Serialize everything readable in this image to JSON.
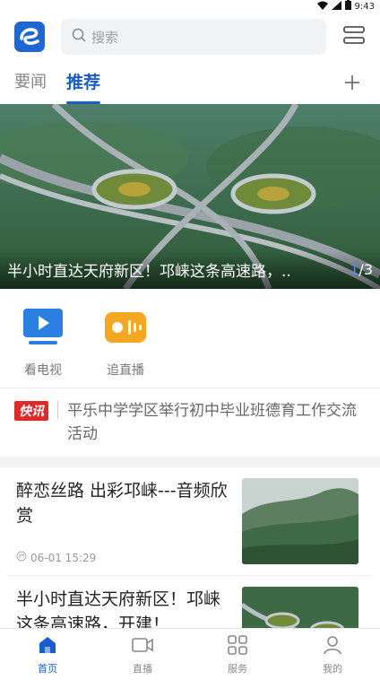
{
  "status": {
    "time": "9:43"
  },
  "header": {
    "search_placeholder": "搜索"
  },
  "tabs": [
    {
      "label": "要闻"
    },
    {
      "label": "推荐"
    }
  ],
  "banner": {
    "caption": "半小时直达天府新区！邛崃这条高速路，..",
    "page_current": "1",
    "page_total": "/3"
  },
  "quick": [
    {
      "label": "看电视"
    },
    {
      "label": "追直播"
    }
  ],
  "flash": {
    "badge": "快讯",
    "text": "平乐中学学区举行初中毕业班德育工作交流活动"
  },
  "news": [
    {
      "title": "醉恋丝路 出彩邛崃---音频欣赏",
      "time": "06-01 15:29"
    },
    {
      "title": "半小时直达天府新区！邛崃这条高速路，开建！"
    }
  ],
  "bottom_nav": [
    {
      "label": "首页"
    },
    {
      "label": "直播"
    },
    {
      "label": "服务"
    },
    {
      "label": "我的"
    }
  ],
  "colors": {
    "accent": "#1a5cc8",
    "flash_red": "#e02a2a"
  }
}
